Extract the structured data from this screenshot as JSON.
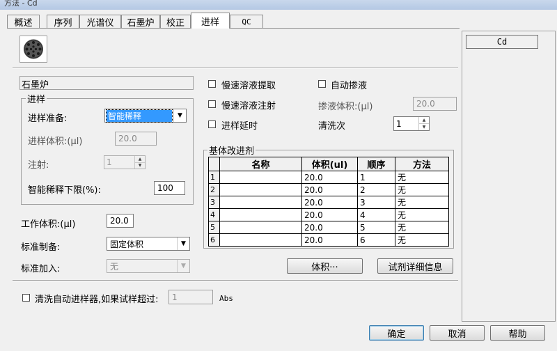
{
  "window": {
    "title": "方法 - Cd"
  },
  "tabs": [
    {
      "label": "概述"
    },
    {
      "label": "序列"
    },
    {
      "label": "光谱仪"
    },
    {
      "label": "石墨炉"
    },
    {
      "label": "校正"
    },
    {
      "label": "进样"
    },
    {
      "label": "QC"
    }
  ],
  "element_list": {
    "selected": "Cd"
  },
  "section": {
    "title": "石墨炉"
  },
  "injection_group": {
    "title": "进样",
    "prep_label": "进样准备:",
    "prep_value": "智能稀释",
    "volume_label": "进样体积:(µl)",
    "volume_value": "20.0",
    "inject_label": "注射:",
    "inject_value": "1",
    "smart_limit_label": "智能稀释下限(%):",
    "smart_limit_value": "100"
  },
  "work_volume": {
    "label": "工作体积:(µl)",
    "value": "20.0"
  },
  "standard_prep": {
    "label": "标准制备:",
    "value": "固定体积"
  },
  "standard_add": {
    "label": "标准加入:",
    "value": "无"
  },
  "options": {
    "slow_extract": "慢速溶液提取",
    "slow_inject": "慢速溶液注射",
    "inject_delay": "进样延时",
    "auto_mix": "自动掺液",
    "mix_volume_label": "掺液体积:(µl)",
    "mix_volume_value": "20.0",
    "wash_label": "清洗次",
    "wash_value": "1"
  },
  "modifier": {
    "title": "基体改进剂",
    "columns": [
      "名称",
      "体积(ul)",
      "顺序",
      "方法"
    ],
    "rows": [
      {
        "idx": "1",
        "name": "",
        "volume": "20.0",
        "order": "1",
        "method": "无"
      },
      {
        "idx": "2",
        "name": "",
        "volume": "20.0",
        "order": "2",
        "method": "无"
      },
      {
        "idx": "3",
        "name": "",
        "volume": "20.0",
        "order": "3",
        "method": "无"
      },
      {
        "idx": "4",
        "name": "",
        "volume": "20.0",
        "order": "4",
        "method": "无"
      },
      {
        "idx": "5",
        "name": "",
        "volume": "20.0",
        "order": "5",
        "method": "无"
      },
      {
        "idx": "6",
        "name": "",
        "volume": "20.0",
        "order": "6",
        "method": "无"
      }
    ],
    "volume_button": "体积···",
    "reagent_button": "试剂详细信息"
  },
  "wash_autosampler": {
    "label": "清洗自动进样器,如果试样超过:",
    "value": "1",
    "unit": "Abs"
  },
  "buttons": {
    "ok": "确定",
    "cancel": "取消",
    "help": "帮助"
  }
}
